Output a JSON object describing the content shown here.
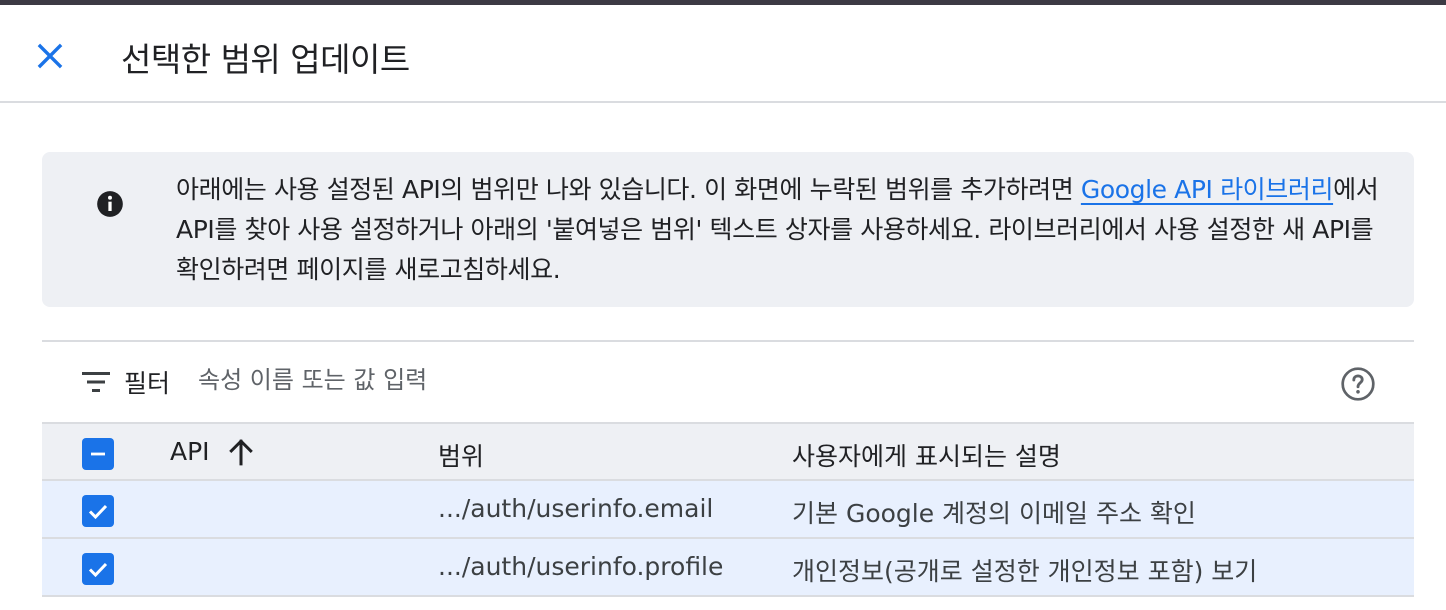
{
  "dialog": {
    "title": "선택한 범위 업데이트"
  },
  "info": {
    "text_before_link": "아래에는 사용 설정된 API의 범위만 나와 있습니다. 이 화면에 누락된 범위를 추가하려면 ",
    "link_text": "Google API 라이브러리",
    "text_after_link": "에서 API를 찾아 사용 설정하거나 아래의 '붙여넣은 범위' 텍스트 상자를 사용하세요. 라이브러리에서 사용 설정한 새 API를 확인하려면 페이지를 새로고침하세요."
  },
  "filter": {
    "label": "필터",
    "placeholder": "속성 이름 또는 값 입력"
  },
  "table": {
    "headers": {
      "api": "API",
      "scope": "범위",
      "description": "사용자에게 표시되는 설명"
    },
    "rows": [
      {
        "api": "",
        "scope": ".../auth/userinfo.email",
        "description": "기본 Google 계정의 이메일 주소 확인",
        "checked": true
      },
      {
        "api": "",
        "scope": ".../auth/userinfo.profile",
        "description": "개인정보(공개로 설정한 개인정보 포함) 보기",
        "checked": true
      }
    ]
  },
  "colors": {
    "accent": "#1a73e8",
    "info_bg": "#eef0f4",
    "selected_row_bg": "#e8f0fe"
  },
  "icons": {
    "close": "close-icon",
    "info": "info-icon",
    "filter": "filter-icon",
    "help": "help-icon",
    "sort": "arrow-up-icon",
    "header_checkbox": "indeterminate-checkbox-icon",
    "row_checkbox": "checked-checkbox-icon"
  }
}
